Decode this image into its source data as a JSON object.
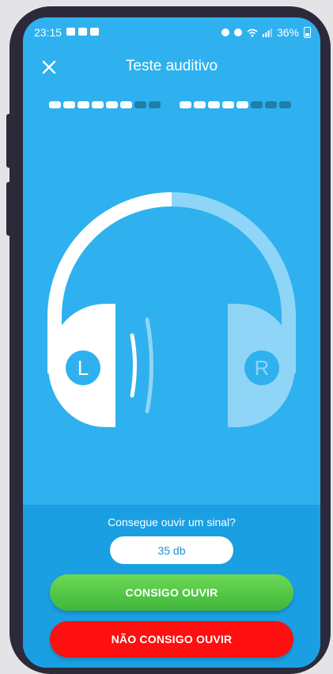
{
  "status_bar": {
    "time": "23:15",
    "battery": "36%"
  },
  "header": {
    "title": "Teste auditivo"
  },
  "progress": {
    "left": {
      "filled": 6,
      "total": 8
    },
    "right": {
      "filled": 5,
      "total": 8
    }
  },
  "headphones": {
    "left_label": "L",
    "right_label": "R"
  },
  "prompt": {
    "question": "Consegue ouvir um sinal?",
    "level": "35 db"
  },
  "buttons": {
    "yes": "CONSIGO OUVIR",
    "no": "NÃO CONSIGO OUVIR"
  },
  "colors": {
    "background": "#2eb1ee",
    "bottom_panel": "#1a9fe3",
    "yes_button": "#4cc443",
    "no_button": "#ff0f0f"
  }
}
